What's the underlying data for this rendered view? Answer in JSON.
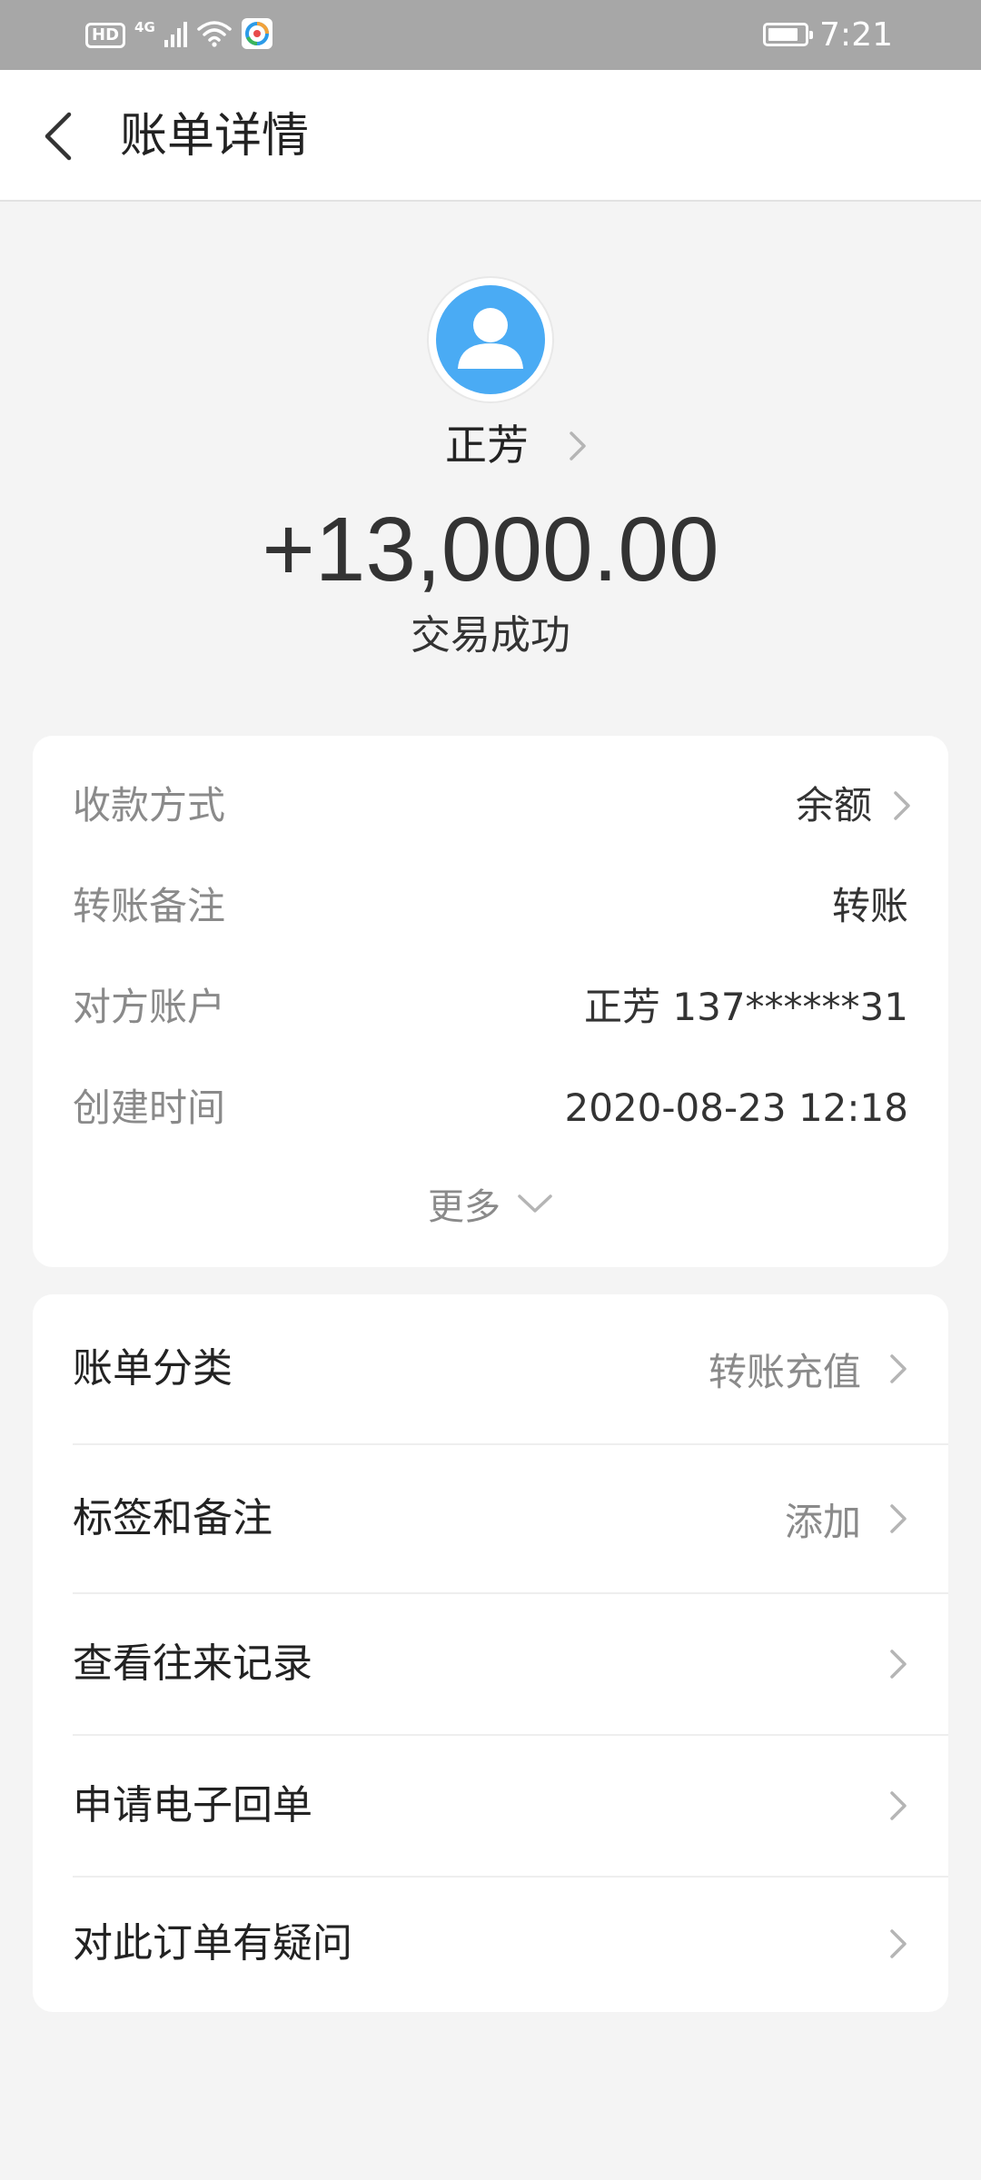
{
  "status_bar": {
    "hd": "HD",
    "network": "4G",
    "time": "7:21",
    "icons": [
      "signal-icon",
      "wifi-icon",
      "app-notification-icon",
      "battery-icon"
    ]
  },
  "header": {
    "title": "账单详情",
    "back_icon": "chevron-left-icon"
  },
  "profile": {
    "name": "正芳",
    "avatar_color": "#4aabf4",
    "amount": "+13,000.00",
    "status": "交易成功"
  },
  "details": {
    "rows": [
      {
        "label": "收款方式",
        "value": "余额",
        "has_chevron": true
      },
      {
        "label": "转账备注",
        "value": "转账",
        "has_chevron": false
      },
      {
        "label": "对方账户",
        "value": "正芳 137******31",
        "has_chevron": false
      },
      {
        "label": "创建时间",
        "value": "2020-08-23 12:18",
        "has_chevron": false
      }
    ],
    "more_label": "更多"
  },
  "actions": {
    "rows": [
      {
        "label": "账单分类",
        "value": "转账充值"
      },
      {
        "label": "标签和备注",
        "value": "添加"
      },
      {
        "label": "查看往来记录",
        "value": ""
      },
      {
        "label": "申请电子回单",
        "value": ""
      },
      {
        "label": "对此订单有疑问",
        "value": ""
      }
    ]
  },
  "colors": {
    "status_bar": "#a7a7a7",
    "page_bg": "#f4f4f4",
    "card_bg": "#ffffff",
    "label_gray": "#8a8a8a",
    "text_dark": "#333333"
  }
}
